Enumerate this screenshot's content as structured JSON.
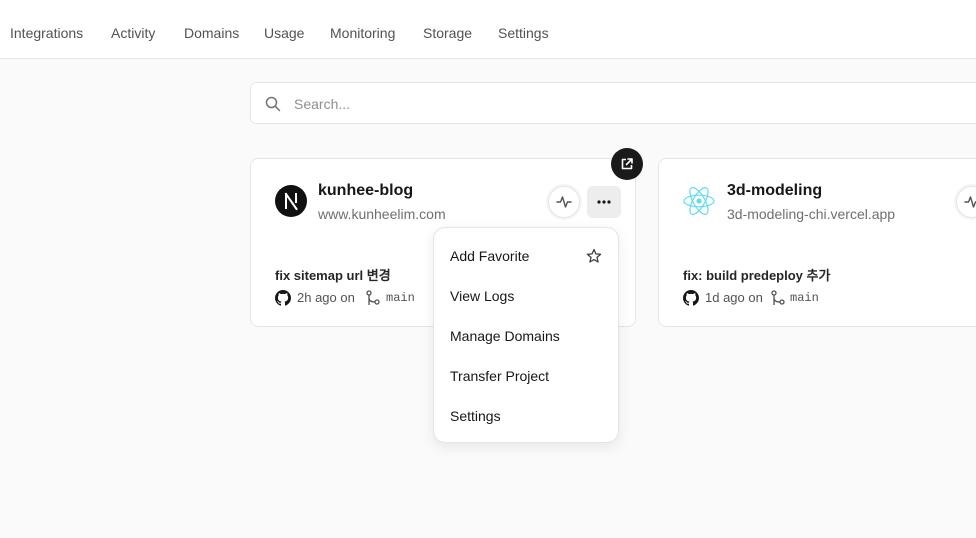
{
  "nav": {
    "tabs": [
      "Integrations",
      "Activity",
      "Domains",
      "Usage",
      "Monitoring",
      "Storage",
      "Settings"
    ]
  },
  "search": {
    "placeholder": "Search..."
  },
  "projects": [
    {
      "name": "kunhee-blog",
      "url": "www.kunheelim.com",
      "commit_message": "fix sitemap url 변경",
      "time": "2h ago on",
      "branch": "main",
      "icon": "nextjs-logo"
    },
    {
      "name": "3d-modeling",
      "url": "3d-modeling-chi.vercel.app",
      "commit_message": "fix: build predeploy 추가",
      "time": "1d ago on",
      "branch": "main",
      "icon": "react-logo"
    }
  ],
  "menu": {
    "items": [
      "Add Favorite",
      "View Logs",
      "Manage Domains",
      "Transfer Project",
      "Settings"
    ]
  },
  "colors": {
    "accent_react": "#61dafb",
    "dark": "#111111"
  }
}
